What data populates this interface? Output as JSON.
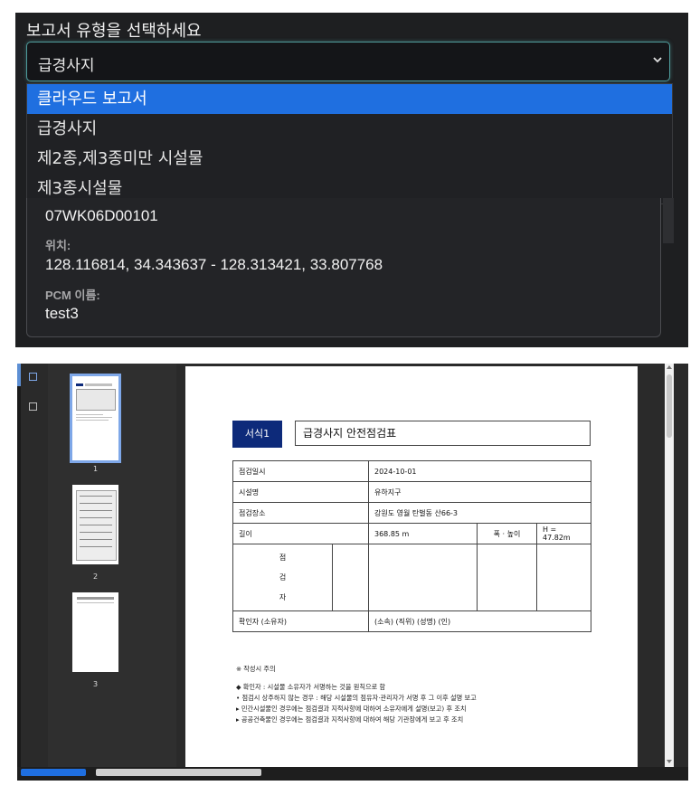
{
  "report_select": {
    "heading": "보고서 유형을 선택하세요",
    "selected_value": "급경사지",
    "options": [
      "클라우드 보고서",
      "급경사지",
      "제2종,제3종미만 시설물",
      "제3종시설물"
    ]
  },
  "details": {
    "id_value": "07WK06D00101",
    "location_label": "위치:",
    "location_value": "128.116814, 34.343637 - 128.313421, 33.807768",
    "pcm_label": "PCM 이름:",
    "pcm_value": "test3"
  },
  "viewer": {
    "page_numbers": [
      "1",
      "2",
      "3"
    ],
    "icons": [
      "thumbnail-view-icon",
      "outline-view-icon"
    ],
    "accent_color": "#1f6fe0"
  },
  "document": {
    "form_badge": "서식1",
    "form_title": "급경사지 안전점검표",
    "rows": {
      "inspect_date_label": "점검일시",
      "inspect_date_value": "2024-10-01",
      "facility_label": "시설명",
      "facility_value": "유하지구",
      "place_label": "점검장소",
      "place_value": "강원도 영월 탄벌동 산66-3",
      "length_label": "길이",
      "length_value": "368.85 m",
      "width_height_label": "폭 · 높이",
      "height_value": "H = 47.82m",
      "inspector_char_1": "점",
      "inspector_char_2": "검",
      "inspector_char_3": "자",
      "confirmer_label": "확인자 (소유자)",
      "confirmer_value": "(소속) (직위) (성명) (인)"
    },
    "notes_title": "※ 작성시 주의",
    "notes": [
      "◆ 확인자 : 시설물 소유자가 서명하는 것을 원칙으로 함",
      "• 점검시 상주하지 않는 경우 : 해당 시설물의 점유자·관리자가 서명 후 그 이후 설명 보고",
      "▸ 민간시설물인 경우에는 점검결과 지적사항에 대하여 소유자에게 설명(보고) 후 조치",
      "▸ 공공건축물인 경우에는 점검결과 지적사항에 대하여 해당 기관장에게 보고 후 조치"
    ]
  }
}
